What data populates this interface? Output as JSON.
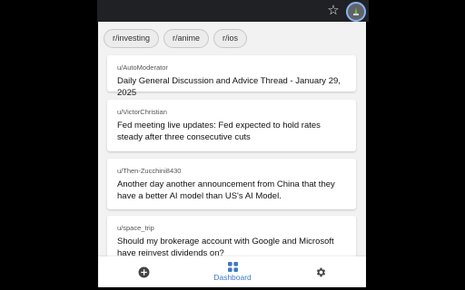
{
  "chips": [
    {
      "label": "r/investing"
    },
    {
      "label": "r/anime"
    },
    {
      "label": "r/ios"
    }
  ],
  "posts": [
    {
      "author": "u/AutoModerator",
      "title": "Daily General Discussion and Advice Thread - January 29, 2025"
    },
    {
      "author": "u/VictorChristian",
      "title": "Fed meeting live updates: Fed expected to hold rates steady after three consecutive cuts"
    },
    {
      "author": "u/Then-Zucchini8430",
      "title": "Another day another announcement from China that they have a better AI model than US's AI Model."
    },
    {
      "author": "u/space_trip",
      "title": "Should my brokerage account with Google and Microsoft have reinvest dividends on?"
    }
  ],
  "nav": {
    "dashboard_label": "Dashboard"
  },
  "colors": {
    "accent": "#3b78c4",
    "background": "#f2f2f2",
    "card": "#ffffff"
  },
  "icons": {
    "bookmark": "star-icon",
    "extension": "extension-icon",
    "add": "add-circle-icon",
    "dashboard": "dashboard-grid-icon",
    "settings": "gear-icon"
  }
}
